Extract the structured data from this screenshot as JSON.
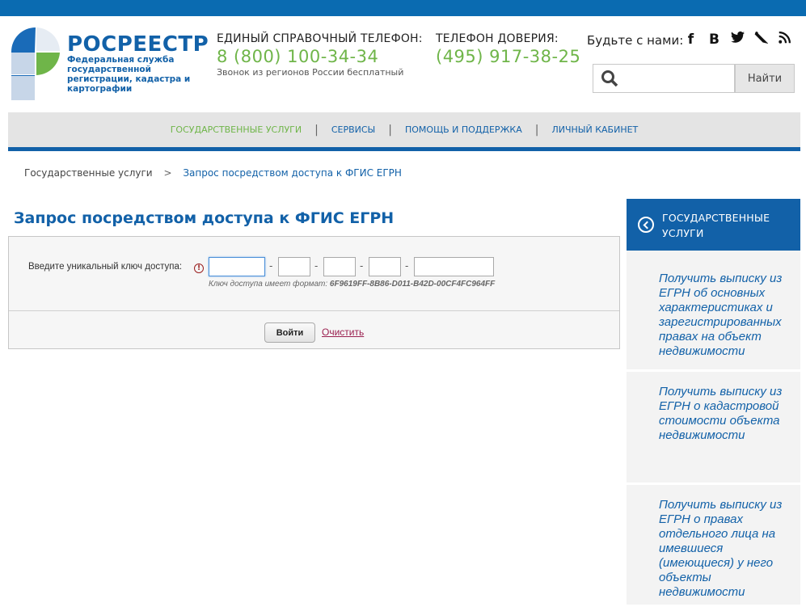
{
  "header": {
    "logo_title": "РОСРЕЕСТР",
    "logo_subtitle": "Федеральная служба государственной регистрации, кадастра и картографии",
    "phone1": {
      "label": "ЕДИНЫЙ СПРАВОЧНЫЙ ТЕЛЕФОН:",
      "number": "8 (800) 100-34-34",
      "note": "Звонок из регионов России бесплатный"
    },
    "phone2": {
      "label": "ТЕЛЕФОН ДОВЕРИЯ:",
      "number": "(495) 917-38-25"
    },
    "social_label": "Будьте с нами:",
    "social_icons": [
      "facebook-icon",
      "vk-icon",
      "twitter-icon",
      "livejournal-icon",
      "rss-icon"
    ],
    "search": {
      "placeholder": "",
      "button_label": "Найти"
    }
  },
  "nav": {
    "items": [
      {
        "label": "ГОСУДАРСТВЕННЫЕ УСЛУГИ",
        "active": true
      },
      {
        "label": "СЕРВИСЫ",
        "active": false
      },
      {
        "label": "ПОМОЩЬ И ПОДДЕРЖКА",
        "active": false
      },
      {
        "label": "ЛИЧНЫЙ КАБИНЕТ",
        "active": false
      }
    ],
    "separator": "|"
  },
  "breadcrumb": {
    "items": [
      "Государственные услуги",
      "Запрос посредством доступа к ФГИС ЕГРН"
    ],
    "separator": ">"
  },
  "page_title": "Запрос посредством доступа к ФГИС ЕГРН",
  "form": {
    "key_label": "Введите уникальный ключ доступа:",
    "info_icon": "!",
    "key_values": [
      "",
      "",
      "",
      "",
      ""
    ],
    "dash": "-",
    "hint_prefix": "Ключ доступа имеет формат:",
    "hint_format": "6F9619FF-8B86-D011-B42D-00CF4FC964FF",
    "enter_label": "Войти",
    "clear_label": "Очистить"
  },
  "sidebar": {
    "header": "ГОСУДАРСТВЕННЫЕ УСЛУГИ",
    "items": [
      {
        "label": "Получить выписку из ЕГРН об основных характеристиках и зарегистрированных правах на объект недвижимости"
      },
      {
        "label": "Получить выписку из ЕГРН о кадастровой стоимости объекта недвижимости"
      },
      {
        "label": "Получить выписку из ЕГРН о правах отдельного лица на имевшиеся (имеющиеся) у него объекты недвижимости"
      }
    ]
  },
  "colors": {
    "brand_blue": "#1261a8",
    "top_bar": "#0a6bb1",
    "accent_green": "#6fb549",
    "clear_link": "#9a1f4f"
  }
}
